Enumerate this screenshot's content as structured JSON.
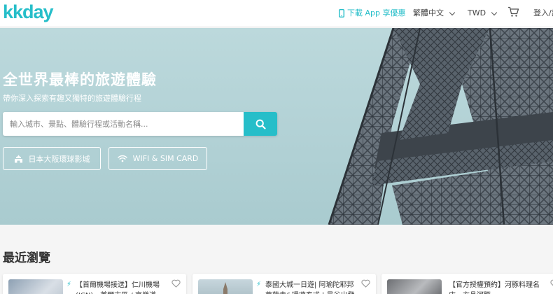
{
  "header": {
    "logo": "kkday",
    "app_download": "下載 App 享優惠",
    "language": "繁體中文",
    "currency": "TWD",
    "login": "登入/註"
  },
  "hero": {
    "title": "全世界最棒的旅遊體驗",
    "subtitle": "帶你深入探索有趣又獨特的旅遊體驗行程",
    "search_placeholder": "輸入城市、景點、體驗行程或活動名稱...",
    "quick_links": [
      {
        "label": "日本大阪環球影城",
        "icon": "attraction-icon"
      },
      {
        "label": "WIFI & SIM CARD",
        "icon": "wifi-icon"
      }
    ]
  },
  "recent": {
    "title": "最近瀏覽",
    "cards": [
      {
        "text": "【首爾機場接送】仁川機場(ICN)、首爾市區 / 京畿道",
        "has_bolt": true
      },
      {
        "text": "泰國大城一日遊| 阿瑜陀耶邦菩薩寺&環遊泰式 | 曼谷出發",
        "has_bolt": true
      },
      {
        "text": "【官方授權預約】河豚料理名店・玄品河豚",
        "has_bolt": false
      }
    ]
  },
  "colors": {
    "accent": "#26bec9",
    "hero_bg": "#b3d2d6",
    "tower": "#5c6670"
  }
}
